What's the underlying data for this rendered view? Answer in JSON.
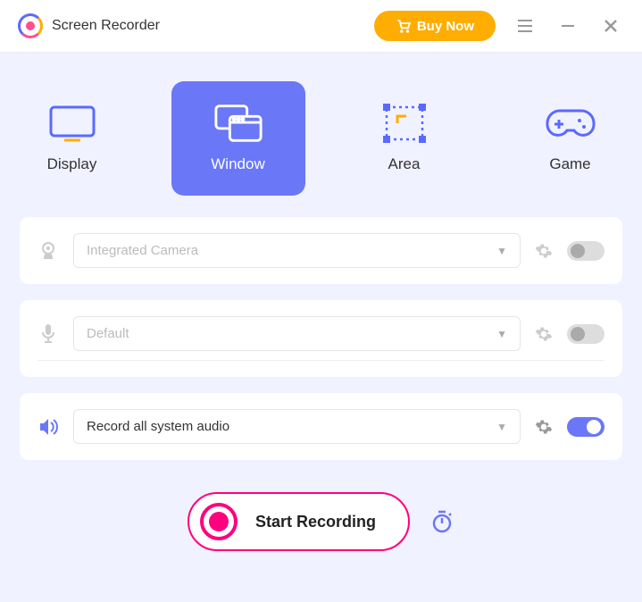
{
  "app": {
    "title": "Screen Recorder",
    "buy": "Buy Now"
  },
  "modes": {
    "display": "Display",
    "window": "Window",
    "area": "Area",
    "game": "Game"
  },
  "rows": {
    "camera": "Integrated Camera",
    "mic": "Default",
    "audio": "Record all system audio"
  },
  "record": "Start Recording"
}
